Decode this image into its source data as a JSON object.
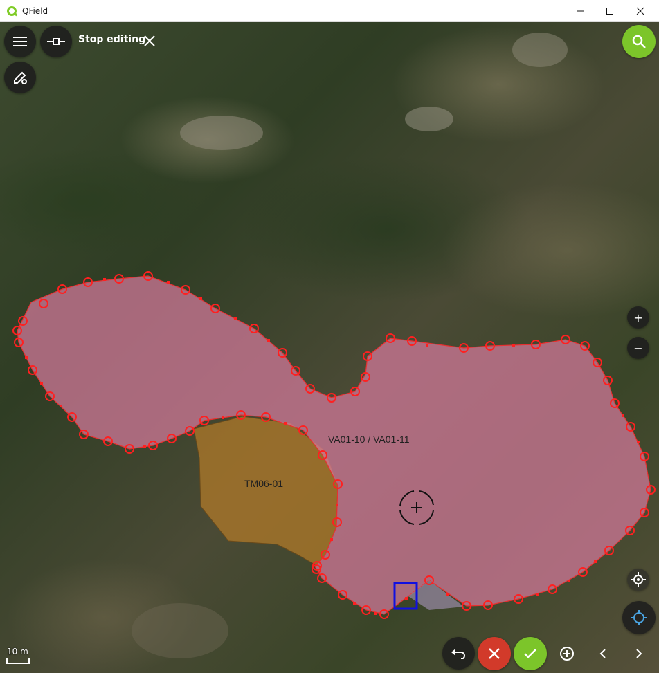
{
  "window": {
    "title": "QField",
    "minimize_icon": "minimize-icon",
    "maximize_icon": "maximize-icon",
    "close_icon": "close-icon"
  },
  "toolbar": {
    "menu_icon": "hamburger-menu-icon",
    "edit_mode_icon": "vertex-edit-icon",
    "edit_label": "Stop editing",
    "stop_icon": "close-icon",
    "digitize_settings_icon": "pencil-settings-icon",
    "search_icon": "search-icon"
  },
  "map": {
    "features": [
      {
        "label": "VA01-10 / VA01-11",
        "fill": "#d67a9c"
      },
      {
        "label": "TM06-01",
        "fill": "#b07a2a"
      }
    ],
    "scale_bar": "10 m",
    "vertex_color": "#ff2020",
    "selected_vertex_color": "#1010e0"
  },
  "controls": {
    "zoom_in": "+",
    "zoom_out": "−",
    "gps_icon": "crosshair-target-icon",
    "locate_icon": "location-icon"
  },
  "bottom_bar": {
    "undo_icon": "undo-icon",
    "cancel_icon": "cancel-icon",
    "confirm_icon": "confirm-check-icon",
    "add_vertex_icon": "add-vertex-icon",
    "prev_icon": "chevron-left-icon",
    "next_icon": "chevron-right-icon",
    "cancel_color": "#d23a2a",
    "confirm_color": "#7cc52a"
  }
}
